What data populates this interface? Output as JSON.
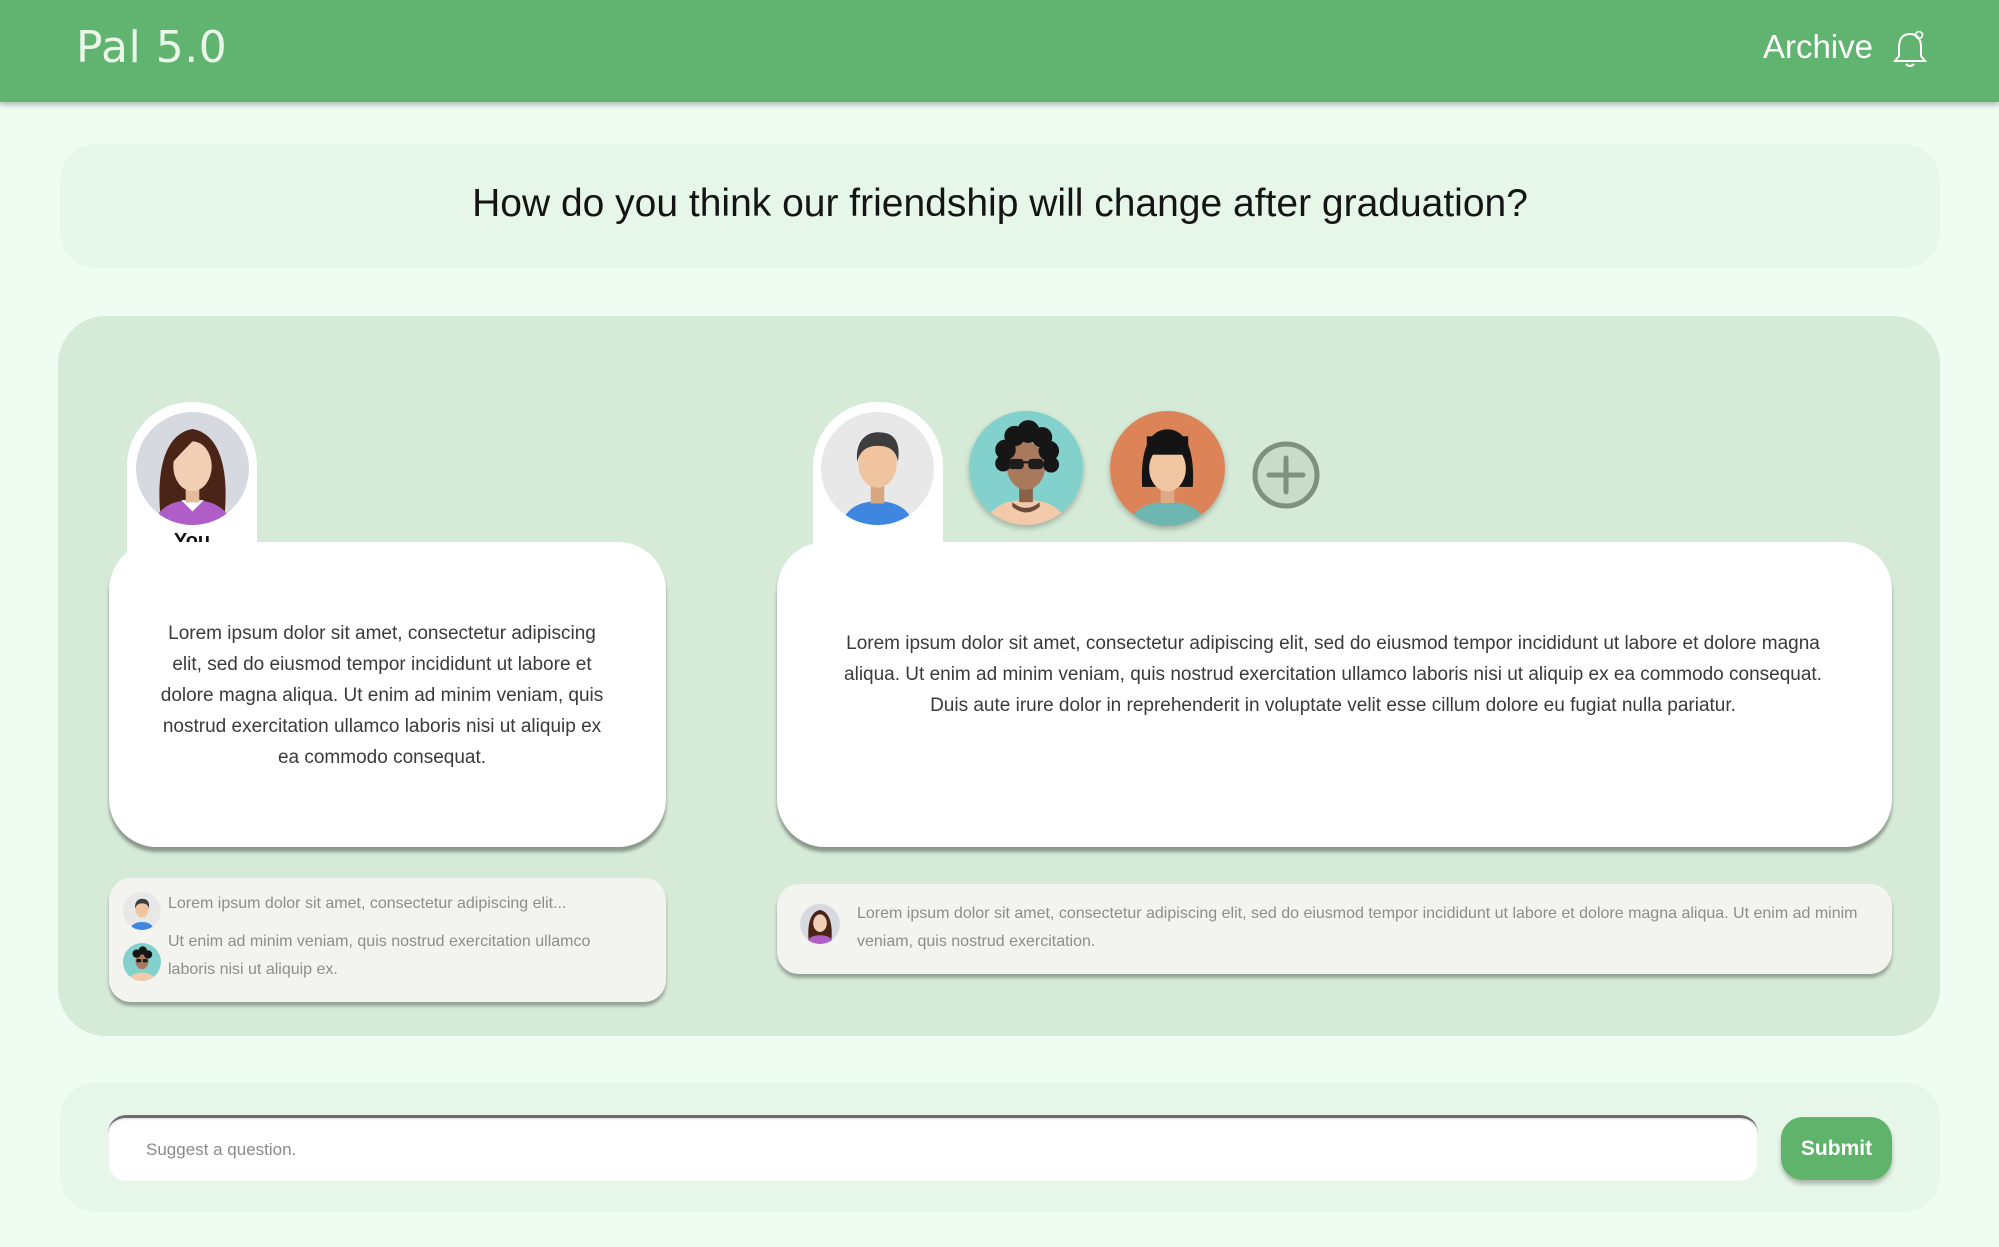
{
  "header": {
    "app_title": "Pal 5.0",
    "archive_label": "Archive",
    "notification_icon": "bell-icon",
    "color": "#61b46f"
  },
  "question": {
    "text": "How do you think our friendship will change after graduation?"
  },
  "you": {
    "label": "You",
    "answer": "Lorem ipsum dolor sit amet, consectetur adipiscing elit, sed do eiusmod tempor incididunt ut labore et dolore magna aliqua. Ut enim ad minim veniam, quis nostrud exercitation ullamco laboris nisi ut aliquip ex ea commodo consequat.",
    "comments": [
      {
        "avatar": "man-avatar-icon",
        "text": "Lorem ipsum dolor sit amet, consectetur adipiscing elit..."
      },
      {
        "avatar": "curly-sunglasses-avatar-icon",
        "text": "Ut enim ad minim veniam, quis nostrud exercitation ullamco laboris nisi ut aliquip ex."
      }
    ]
  },
  "friends": {
    "avatars": [
      "man-avatar-icon",
      "curly-sunglasses-avatar-icon",
      "bob-hair-avatar-icon"
    ],
    "add_icon": "add-friend-icon",
    "answer": "Lorem ipsum dolor sit amet, consectetur adipiscing elit, sed do eiusmod tempor incididunt ut labore et dolore magna aliqua. Ut enim ad minim veniam, quis nostrud exercitation ullamco laboris nisi ut aliquip ex ea commodo consequat. Duis aute irure dolor in reprehenderit in voluptate velit esse cillum dolore eu fugiat nulla pariatur.",
    "comments": [
      {
        "avatar": "woman-avatar-icon",
        "text": "Lorem ipsum dolor sit amet, consectetur adipiscing elit, sed do eiusmod tempor incididunt ut labore et dolore magna aliqua. Ut enim ad minim veniam, quis nostrud exercitation."
      }
    ]
  },
  "suggest": {
    "placeholder": "Suggest a question.",
    "value": "",
    "submit_label": "Submit",
    "submit_color": "#5fb36b"
  }
}
